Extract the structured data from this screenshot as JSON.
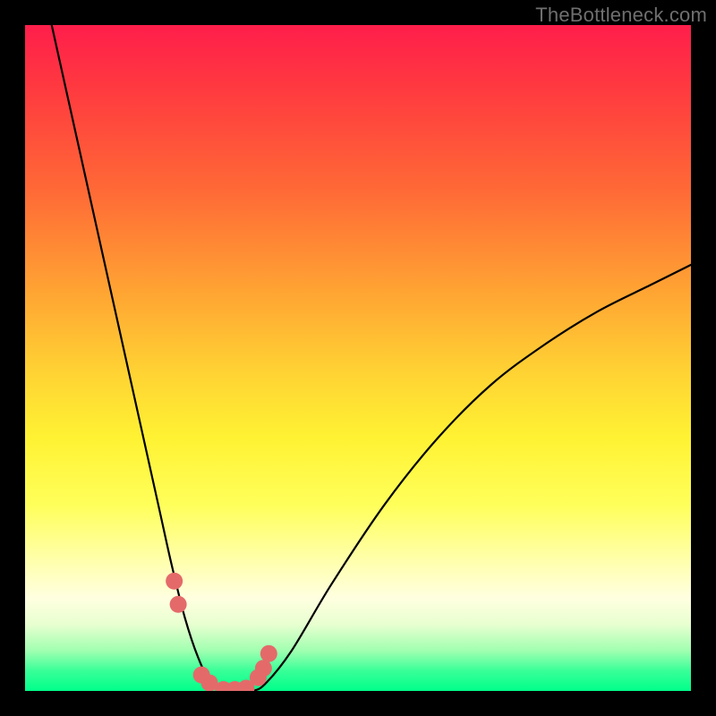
{
  "watermark": "TheBottleneck.com",
  "chart_data": {
    "type": "line",
    "title": "",
    "xlabel": "",
    "ylabel": "",
    "xlim": [
      0,
      100
    ],
    "ylim": [
      0,
      100
    ],
    "grid": false,
    "legend": false,
    "background_gradient": {
      "top": "#ff1e4b",
      "mid": "#fff233",
      "bottom": "#00ff8a"
    },
    "series": [
      {
        "name": "bottleneck-curve",
        "color": "#000000",
        "x": [
          4,
          8,
          12,
          16,
          20,
          22,
          24,
          26,
          28,
          30,
          32,
          34,
          36,
          40,
          46,
          54,
          62,
          70,
          78,
          86,
          94,
          100
        ],
        "values": [
          100,
          82,
          64,
          46,
          28,
          19,
          11,
          5,
          1,
          0,
          0,
          0,
          1,
          6,
          16,
          28,
          38,
          46,
          52,
          57,
          61,
          64
        ]
      },
      {
        "name": "trough-markers",
        "color": "#e46a6a",
        "type": "scatter",
        "x": [
          22.4,
          23.0,
          26.5,
          27.7,
          29.8,
          31.5,
          33.2,
          35.0,
          35.8,
          36.6
        ],
        "values": [
          16.5,
          13.0,
          2.4,
          1.2,
          0.2,
          0.2,
          0.4,
          2.0,
          3.4,
          5.6
        ]
      }
    ]
  }
}
